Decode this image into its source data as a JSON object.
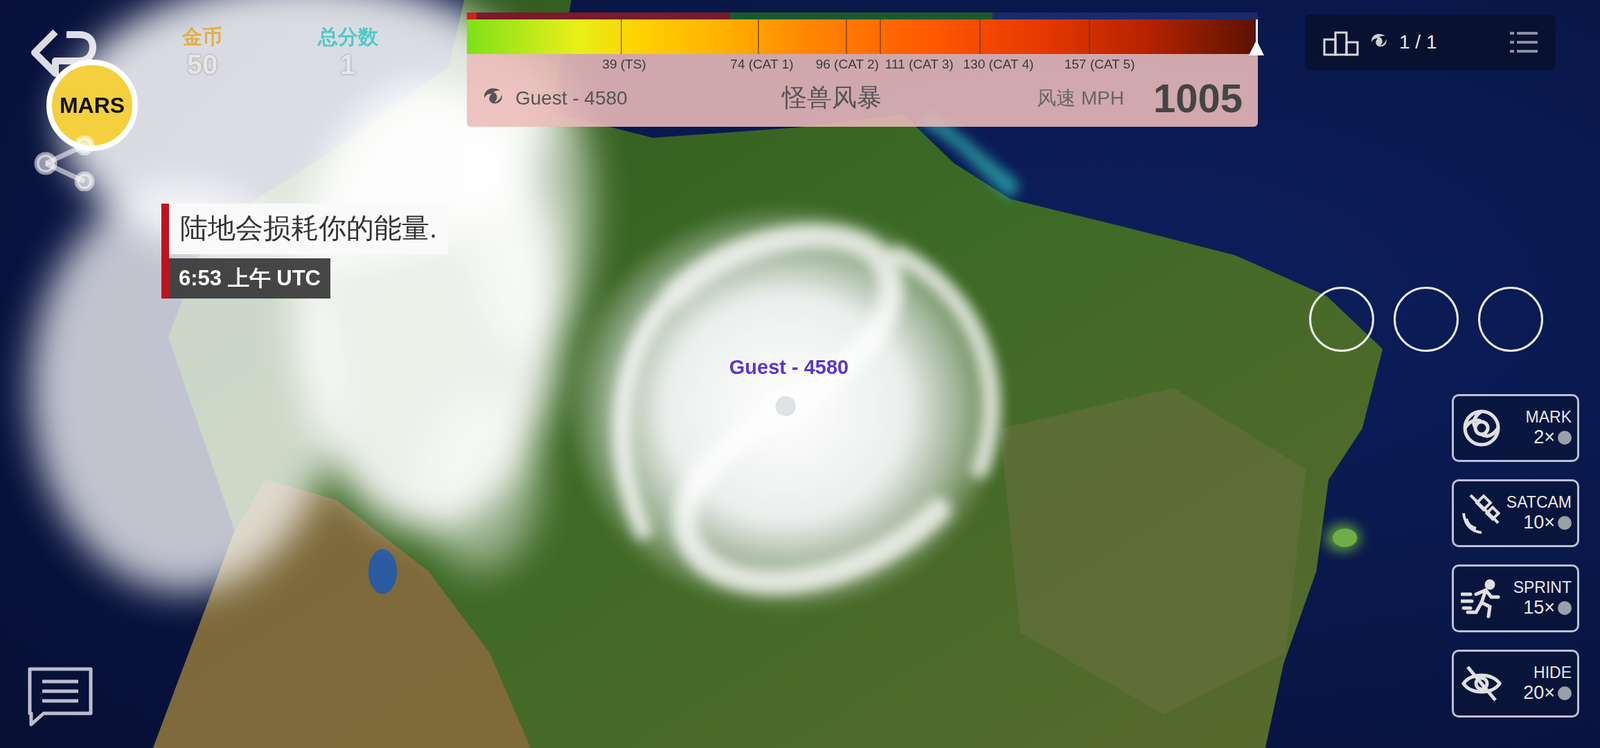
{
  "player": {
    "badge": "MARS"
  },
  "stats": [
    {
      "label": "金币",
      "value": "50"
    },
    {
      "label": "总分数",
      "value": "1"
    }
  ],
  "wind_scale": {
    "ticks": [
      "39 (TS)",
      "74 (CAT 1)",
      "96 (CAT 2)",
      "111 (CAT 3)",
      "130 (CAT 4)",
      "157 (CAT 5)"
    ],
    "level": 1
  },
  "storm_panel": {
    "name": "Guest - 4580",
    "title": "怪兽风暴",
    "unit": "风速 MPH",
    "speed": "1005"
  },
  "ranking": {
    "count": "1 / 1"
  },
  "message": {
    "text": "陆地会损耗你的能量.",
    "time": "6:53 上午 UTC"
  },
  "storm_label": "Guest - 4580",
  "slots": [
    {
      "filled": false
    },
    {
      "filled": false
    },
    {
      "filled": false
    }
  ],
  "powerups": [
    {
      "label": "MARK",
      "cost": "2×"
    },
    {
      "label": "SATCAM",
      "cost": "10×"
    },
    {
      "label": "SPRINT",
      "cost": "15×"
    },
    {
      "label": "HIDE",
      "cost": "20×"
    }
  ]
}
